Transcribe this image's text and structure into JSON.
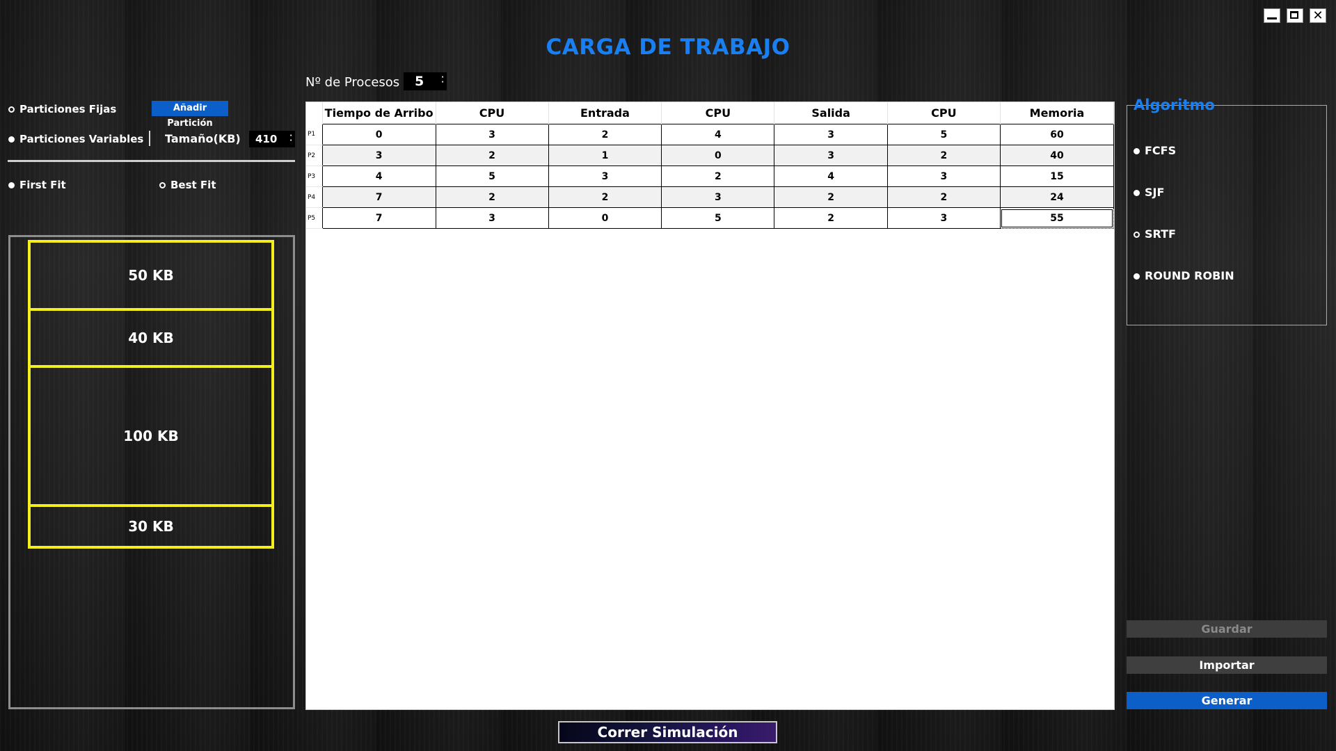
{
  "window": {
    "minimize": "",
    "maximize": "",
    "close": "✕"
  },
  "title": "CARGA DE TRABAJO",
  "processes": {
    "label": "Nº de Procesos",
    "value": "5"
  },
  "partitions": {
    "fixed_label": "Particiones Fijas",
    "fixed_selected": false,
    "add_button": "Añadir Partición",
    "variable_label": "Particiones Variables",
    "variable_selected": true,
    "size_label": "Tamaño(KB)",
    "size_value": "410"
  },
  "fit": {
    "first_fit": "First Fit",
    "first_fit_selected": true,
    "best_fit": "Best Fit",
    "best_fit_selected": false
  },
  "memory_blocks": [
    "50 KB",
    "40 KB",
    "100 KB",
    "30 KB"
  ],
  "table": {
    "columns": [
      "Tiempo de Arribo",
      "CPU",
      "Entrada",
      "CPU",
      "Salida",
      "CPU",
      "Memoria"
    ],
    "rows": [
      {
        "label": "P1",
        "cells": [
          "0",
          "3",
          "2",
          "4",
          "3",
          "5",
          "60"
        ]
      },
      {
        "label": "P2",
        "cells": [
          "3",
          "2",
          "1",
          "0",
          "3",
          "2",
          "40"
        ]
      },
      {
        "label": "P3",
        "cells": [
          "4",
          "5",
          "3",
          "2",
          "4",
          "3",
          "15"
        ]
      },
      {
        "label": "P4",
        "cells": [
          "7",
          "2",
          "2",
          "3",
          "2",
          "2",
          "24"
        ]
      },
      {
        "label": "P5",
        "cells": [
          "7",
          "3",
          "0",
          "5",
          "2",
          "3",
          "55"
        ]
      }
    ]
  },
  "algorithm": {
    "legend": "Algoritmo",
    "options": [
      {
        "label": "FCFS",
        "selected": true
      },
      {
        "label": "SJF",
        "selected": true
      },
      {
        "label": "SRTF",
        "selected": false
      },
      {
        "label": "ROUND ROBIN",
        "selected": true
      }
    ]
  },
  "buttons": {
    "guardar": "Guardar",
    "importar": "Importar",
    "generar": "Generar",
    "run": "Correr Simulación"
  },
  "colors": {
    "accent": "#1a7ff0",
    "partition_border": "#f4ee1d",
    "primary_button": "#0c5ec9"
  }
}
